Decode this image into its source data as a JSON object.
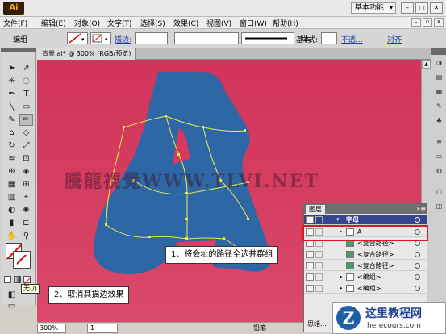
{
  "titlebar": {
    "logo": "Ai",
    "workspace": "基本功能"
  },
  "menu": [
    "文件(F)",
    "编辑(E)",
    "对象(O)",
    "文字(T)",
    "选择(S)",
    "效果(C)",
    "视图(V)",
    "窗口(W)",
    "帮助(H)"
  ],
  "control": {
    "group_label": "编组",
    "stroke_label": "描边:",
    "basic": "基本",
    "style_label": "样式:",
    "opacity": "不透...",
    "align": "对齐"
  },
  "document": {
    "tab": "背景.ai* @ 300% (RGB/预览)"
  },
  "status": {
    "zoom": "300%",
    "page": "1",
    "tool": "铅笔"
  },
  "tooltip": "无(/)",
  "watermark": "騰龍視覺WWW.TLVI.NET",
  "callouts": {
    "step1": "1、将会址的路径全选并群组",
    "step2": "2、取消其描边效果"
  },
  "layers": {
    "tab": "图层",
    "layer_name": "字母",
    "rows": [
      "A",
      "<复合路径>",
      "<复合路径>",
      "<复合路径>",
      "<编组>",
      "<编组>"
    ],
    "footer": "思绪..."
  },
  "brand": {
    "logo": "Z",
    "title": "这里教程网",
    "url": "herecours.com"
  },
  "colors": {
    "canvas": "#d1345a",
    "shape": "#2e67a6",
    "path": "#e8ea4a",
    "layer_row": "#36438f"
  }
}
